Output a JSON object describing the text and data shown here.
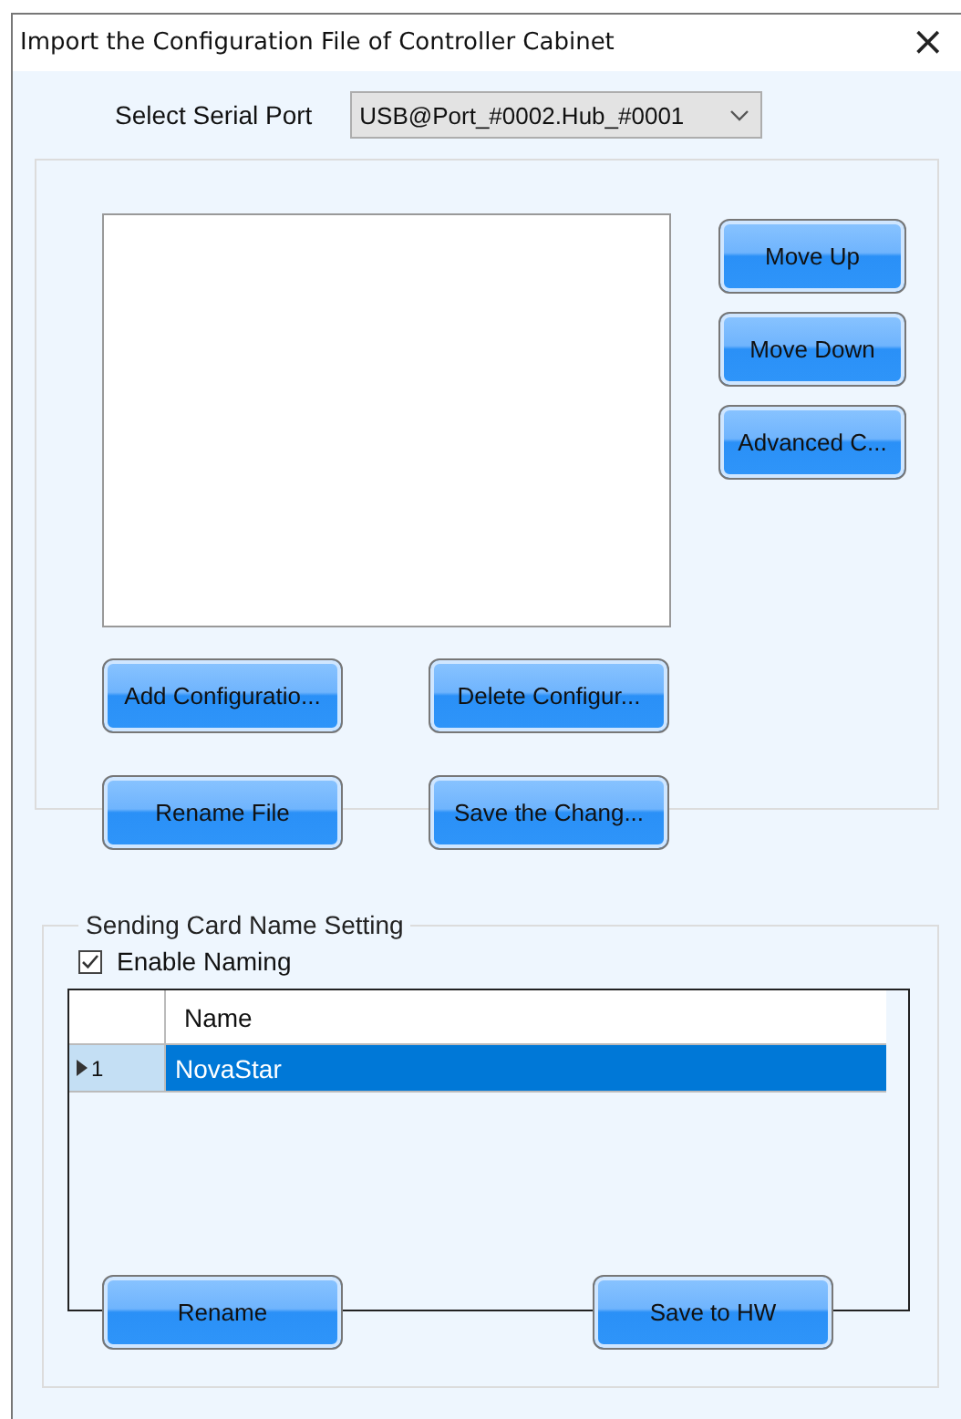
{
  "window": {
    "title": "Import the Configuration File of Controller Cabinet",
    "close": "×"
  },
  "serial_port": {
    "label": "Select Serial Port",
    "value": "USB@Port_#0002.Hub_#0001"
  },
  "side_buttons": [
    "Move Up",
    "Move Down",
    "Advanced C..."
  ],
  "file_buttons": [
    "Add Configuratio...",
    "Delete Configur...",
    "Rename File",
    "Save the Chang..."
  ],
  "naming": {
    "title": "Sending Card Name Setting",
    "enable": {
      "label": "Enable Naming",
      "checked": true
    },
    "table": {
      "columns": [
        "Name"
      ],
      "rows": [
        {
          "index": "1",
          "name": "NovaStar",
          "selected": true
        }
      ]
    },
    "buttons": [
      "Rename",
      "Save to HW"
    ]
  }
}
